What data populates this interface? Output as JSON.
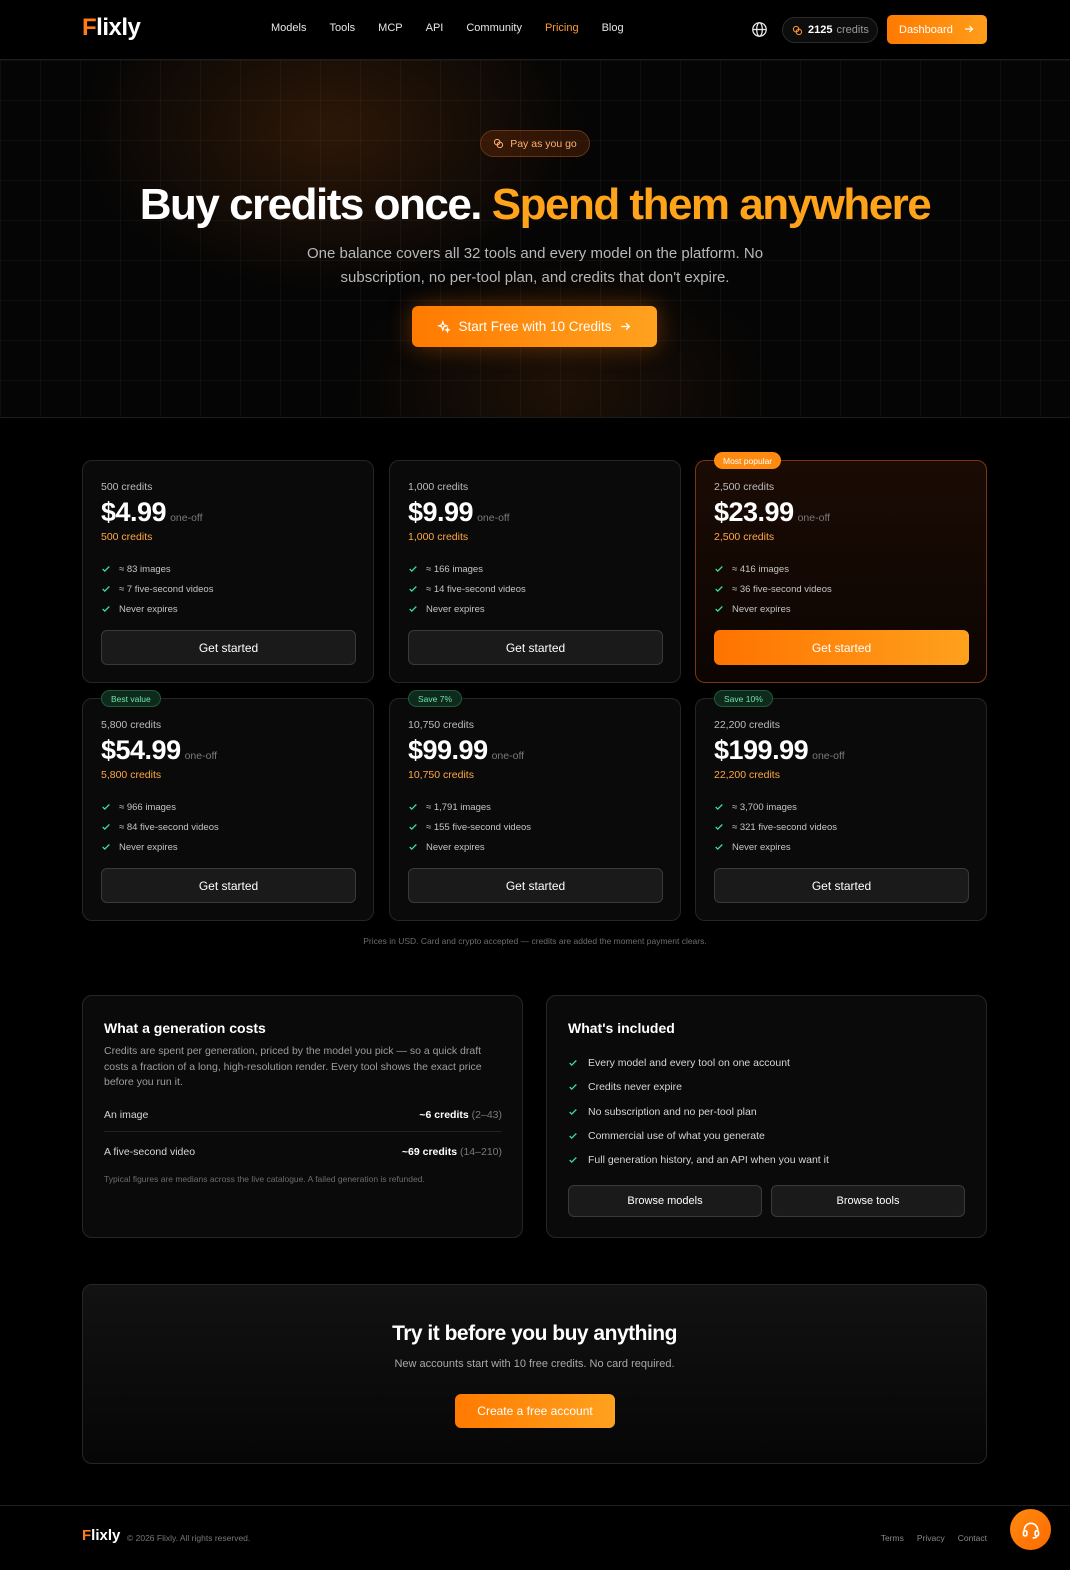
{
  "nav": {
    "logo_f": "F",
    "logo_rest": "lixly",
    "links": [
      "Models",
      "Tools",
      "MCP",
      "API",
      "Community",
      "Pricing",
      "Blog"
    ],
    "active_link": "Pricing",
    "credits_value": "2125",
    "credits_label": "credits",
    "dashboard_label": "Dashboard"
  },
  "hero": {
    "badge": "Pay as you go",
    "title_plain": "Buy credits once.",
    "title_highlight": "Spend them anywhere",
    "subtitle": "One balance covers all 32 tools and every model on the platform. No subscription, no per-tool plan, and credits that don't expire.",
    "cta": "Start Free with 10 Credits"
  },
  "plans": [
    {
      "tag": "",
      "credits_top": "500 credits",
      "price": "$4.99",
      "price_suffix": "one-off",
      "credits_orange": "500 credits",
      "features": [
        "≈ 83 images",
        "≈ 7 five-second videos",
        "Never expires"
      ],
      "button": "Get started"
    },
    {
      "tag": "",
      "credits_top": "1,000 credits",
      "price": "$9.99",
      "price_suffix": "one-off",
      "credits_orange": "1,000 credits",
      "features": [
        "≈ 166 images",
        "≈ 14 five-second videos",
        "Never expires"
      ],
      "button": "Get started"
    },
    {
      "tag": "Most popular",
      "credits_top": "2,500 credits",
      "price": "$23.99",
      "price_suffix": "one-off",
      "credits_orange": "2,500 credits",
      "features": [
        "≈ 416 images",
        "≈ 36 five-second videos",
        "Never expires"
      ],
      "button": "Get started"
    },
    {
      "tag": "Best value",
      "credits_top": "5,800 credits",
      "price": "$54.99",
      "price_suffix": "one-off",
      "credits_orange": "5,800 credits",
      "features": [
        "≈ 966 images",
        "≈ 84 five-second videos",
        "Never expires"
      ],
      "button": "Get started"
    },
    {
      "tag": "Save 7%",
      "credits_top": "10,750 credits",
      "price": "$99.99",
      "price_suffix": "one-off",
      "credits_orange": "10,750 credits",
      "features": [
        "≈ 1,791 images",
        "≈ 155 five-second videos",
        "Never expires"
      ],
      "button": "Get started"
    },
    {
      "tag": "Save 10%",
      "credits_top": "22,200 credits",
      "price": "$199.99",
      "price_suffix": "one-off",
      "credits_orange": "22,200 credits",
      "features": [
        "≈ 3,700 images",
        "≈ 321 five-second videos",
        "Never expires"
      ],
      "button": "Get started"
    }
  ],
  "prices_note": "Prices in USD. Card and crypto accepted — credits are added the moment payment clears.",
  "costs": {
    "title": "What a generation costs",
    "description": "Credits are spent per generation, priced by the model you pick — so a quick draft costs a fraction of a long, high-resolution render. Every tool shows the exact price before you run it.",
    "rows": [
      {
        "label": "An image",
        "value": "~6 credits",
        "range": "(2–43)"
      },
      {
        "label": "A five-second video",
        "value": "~69 credits",
        "range": "(14–210)"
      }
    ],
    "footnote": "Typical figures are medians across the live catalogue. A failed generation is refunded."
  },
  "included": {
    "title": "What's included",
    "items": [
      "Every model and every tool on one account",
      "Credits never expire",
      "No subscription and no per-tool plan",
      "Commercial use of what you generate",
      "Full generation history, and an API when you want it"
    ],
    "browse_models": "Browse models",
    "browse_tools": "Browse tools"
  },
  "try": {
    "title": "Try it before you buy anything",
    "subtitle": "New accounts start with 10 free credits. No card required.",
    "cta": "Create a free account"
  },
  "footer": {
    "logo_f": "F",
    "logo_rest": "lixly",
    "copyright": "© 2026 Flixly. All rights reserved.",
    "links": [
      "Terms",
      "Privacy",
      "Contact"
    ]
  },
  "colors": {
    "accent": "#ff8a10",
    "accent_light": "#ffa31a",
    "check_green": "#3ddc97",
    "background": "#000000"
  }
}
